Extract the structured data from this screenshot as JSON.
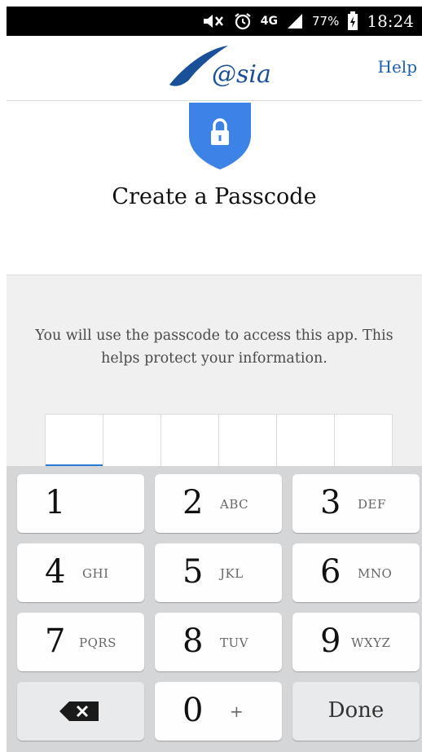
{
  "status_bar": {
    "battery_percent": "77%",
    "network": "4G",
    "time": "18:24"
  },
  "header": {
    "logo_text": "@sia",
    "help_label": "Help"
  },
  "page": {
    "title": "Create a Passcode",
    "instruction": "You will use the passcode to access this app. This helps protect your information."
  },
  "passcode": {
    "length": 6,
    "entered": 0
  },
  "keypad": {
    "keys": [
      {
        "num": "1",
        "letters": ""
      },
      {
        "num": "2",
        "letters": "ABC"
      },
      {
        "num": "3",
        "letters": "DEF"
      },
      {
        "num": "4",
        "letters": "GHI"
      },
      {
        "num": "5",
        "letters": "JKL"
      },
      {
        "num": "6",
        "letters": "MNO"
      },
      {
        "num": "7",
        "letters": "PQRS"
      },
      {
        "num": "8",
        "letters": "TUV"
      },
      {
        "num": "9",
        "letters": "WXYZ"
      },
      {
        "num": "0",
        "letters": "+"
      }
    ],
    "done_label": "Done"
  },
  "colors": {
    "accent": "#2a7bd6",
    "shield": "#3d82e6",
    "logo": "#1a4f99"
  },
  "icons": {
    "shield": "shield-lock-icon",
    "backspace": "backspace-icon"
  }
}
